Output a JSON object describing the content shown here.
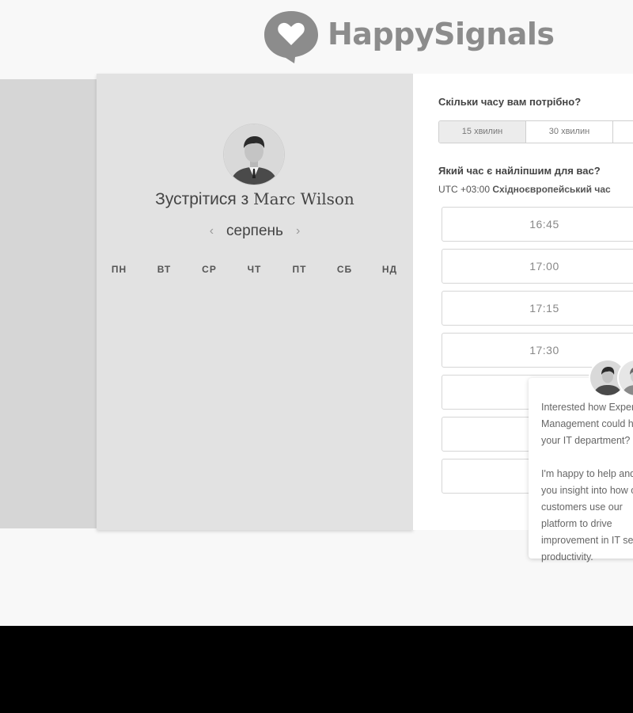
{
  "brand": {
    "name": "HappySignals"
  },
  "calendar": {
    "title_prefix": "Зустрітися з",
    "host_name": "Marc Wilson",
    "month": "серпень",
    "prev_arrow": "‹",
    "next_arrow": "›",
    "weekdays": [
      "ПН",
      "ВТ",
      "СР",
      "ЧТ",
      "ПТ",
      "СБ",
      "НД"
    ]
  },
  "booking": {
    "duration_question": "Скільки часу вам потрібно?",
    "durations": [
      "15 хвилин",
      "30 хвилин"
    ],
    "selected_duration": "15 хвилин",
    "time_question": "Який час є найліпшим для вас?",
    "timezone_offset": "UTC +03:00",
    "timezone_name": "Східноєвропейський час",
    "slots": [
      "16:45",
      "17:00",
      "17:15",
      "17:30",
      "",
      "",
      ""
    ]
  },
  "chat": {
    "message": "Interested how Experience Management could help your IT department?\n\nI'm happy to help and give you insight into how our customers use our platform to drive improvement in IT service productivity."
  },
  "colors": {
    "page_bg": "#f8f8f8",
    "panel_left": "#e2e2e2",
    "logo_gray": "#8c8c8c"
  }
}
